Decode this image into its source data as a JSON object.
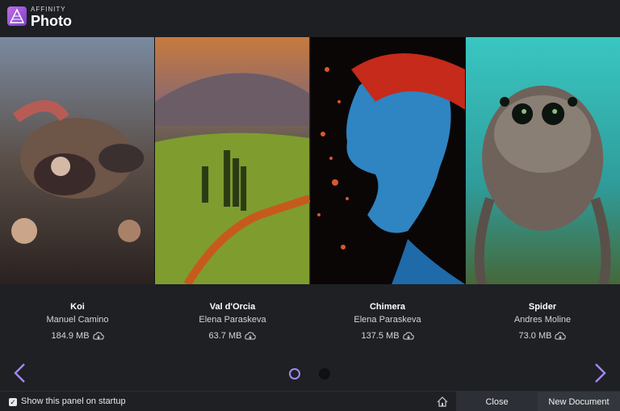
{
  "brand": {
    "small": "AFFINITY",
    "big": "Photo"
  },
  "gallery": [
    {
      "title": "Koi",
      "author": "Manuel Camino",
      "size": "184.9 MB",
      "image": "koi-fish-painting"
    },
    {
      "title": "Val d'Orcia",
      "author": "Elena Paraskeva",
      "size": "63.7 MB",
      "image": "tuscany-landscape"
    },
    {
      "title": "Chimera",
      "author": "Elena Paraskeva",
      "size": "137.5 MB",
      "image": "blue-face-splash"
    },
    {
      "title": "Spider",
      "author": "Andres Moline",
      "size": "73.0 MB",
      "image": "jumping-spider-macro"
    }
  ],
  "pagination": {
    "count": 2,
    "active": 1
  },
  "footer": {
    "show_on_startup_label": "Show this panel on startup",
    "show_on_startup_checked": true,
    "close_label": "Close",
    "new_document_label": "New Document"
  },
  "colors": {
    "accent": "#a487f2",
    "background": "#1e2024"
  },
  "icons": [
    "affinity-photo-logo",
    "cloud-download-icon",
    "chevron-left-icon",
    "chevron-right-icon",
    "home-icon",
    "checkbox-checked-icon"
  ]
}
